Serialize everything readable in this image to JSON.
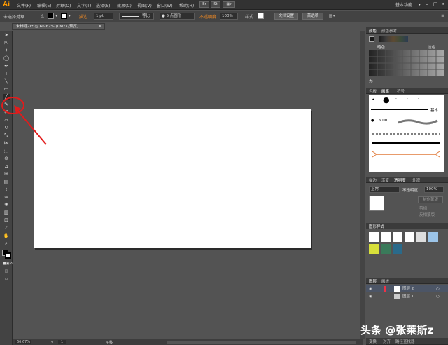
{
  "app": {
    "logo": "Ai",
    "workspace": "基本功能"
  },
  "menu": [
    "文件(F)",
    "编辑(E)",
    "对象(O)",
    "文字(T)",
    "选择(S)",
    "效果(C)",
    "视图(V)",
    "窗口(W)",
    "帮助(H)"
  ],
  "control": {
    "selection": "未选择对象",
    "stroke_label": "描边",
    "stroke_value": "1 pt",
    "profile": "等比",
    "brush": "5 点圆形",
    "opacity_label": "不透明度",
    "opacity_value": "100%",
    "style_label": "样式",
    "doc_setup": "文档设置",
    "prefs": "首选项"
  },
  "document": {
    "tab": "未标题-1* @ 66.67% (CMYK/预览)"
  },
  "status": {
    "zoom": "66.67%",
    "page": "1",
    "mode": "平移"
  },
  "panels": {
    "color_tabs": [
      "颜色",
      "颜色参考"
    ],
    "color_group_left": "暗色",
    "color_group_right": "淡色",
    "color_none": "无",
    "brush_tabs": [
      "色板",
      "画笔",
      "符号"
    ],
    "brush_basic": "基本",
    "brush_size": "6.00",
    "trans_tabs": [
      "描边",
      "渐变",
      "透明度",
      "外观"
    ],
    "blend_mode": "正常",
    "trans_opacity_label": "不透明度",
    "trans_opacity_value": "100%",
    "make_mask": "制作蒙版",
    "clip": "剪切",
    "invert": "反相蒙版",
    "graphic_styles": "图形样式",
    "layers_tabs": [
      "图层",
      "画板"
    ],
    "layer2": "图层 2",
    "layer1": "图层 1",
    "bottom_tabs": [
      "变换",
      "对齐",
      "路径查找器"
    ]
  },
  "watermark": "头条 @张莱斯z",
  "colors": {
    "accent": "#f08a24",
    "annotation": "#e21b1b"
  }
}
